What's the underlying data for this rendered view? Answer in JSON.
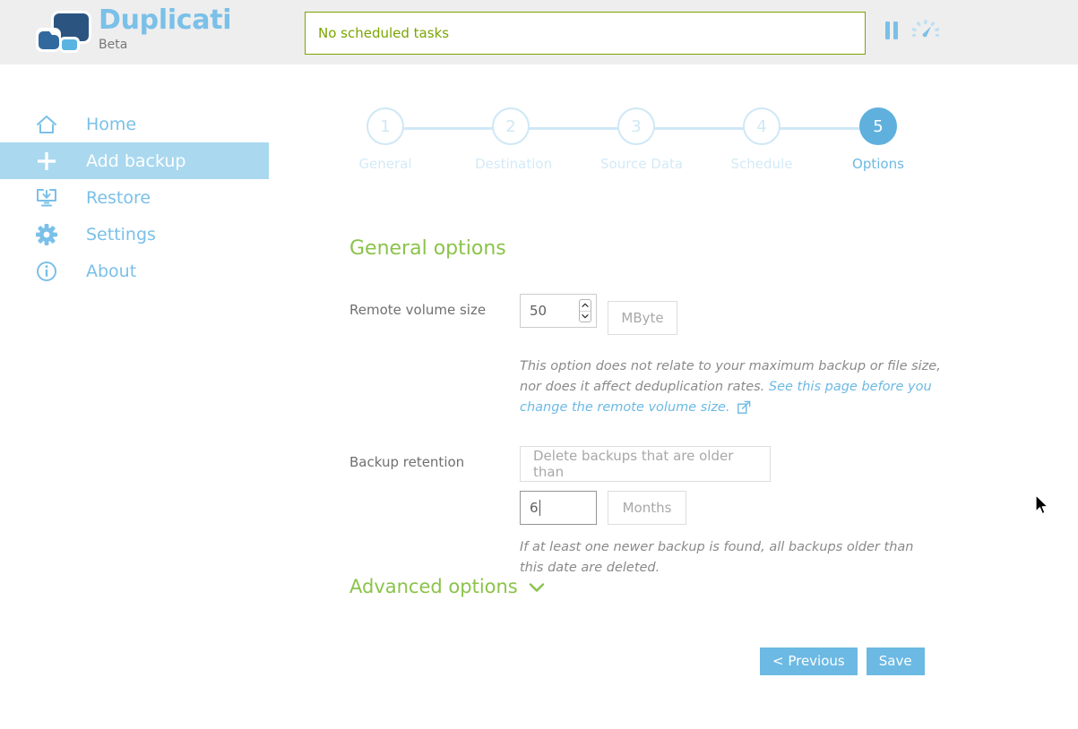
{
  "header": {
    "brand_title": "Duplicati",
    "brand_sub": "Beta",
    "logo_icon": "duplicati-logo-icon",
    "task_status": "No scheduled tasks",
    "pause_icon": "pause-icon",
    "throttle_icon": "speedometer-icon"
  },
  "sidebar": {
    "items": [
      {
        "label": "Home",
        "icon": "home-icon",
        "name": "home",
        "active": false
      },
      {
        "label": "Add backup",
        "icon": "plus-icon",
        "name": "add-backup",
        "active": true
      },
      {
        "label": "Restore",
        "icon": "restore-icon",
        "name": "restore",
        "active": false
      },
      {
        "label": "Settings",
        "icon": "gear-icon",
        "name": "settings",
        "active": false
      },
      {
        "label": "About",
        "icon": "info-circle-icon",
        "name": "about",
        "active": false
      }
    ]
  },
  "stepper": {
    "steps": [
      {
        "number": "1",
        "label": "General",
        "active": false
      },
      {
        "number": "2",
        "label": "Destination",
        "active": false
      },
      {
        "number": "3",
        "label": "Source Data",
        "active": false
      },
      {
        "number": "4",
        "label": "Schedule",
        "active": false
      },
      {
        "number": "5",
        "label": "Options",
        "active": true
      }
    ]
  },
  "main": {
    "section_title": "General options",
    "remote_volume": {
      "label": "Remote volume size",
      "value": "50",
      "unit": "MByte",
      "help_part1": "This option does not relate to your maximum backup or file size, nor does it affect deduplication rates. ",
      "help_link": "See this page before you change the remote volume size.",
      "help_link_icon": "external-link-icon"
    },
    "backup_retention": {
      "label": "Backup retention",
      "policy": "Delete backups that are older than",
      "value": "6",
      "unit": "Months",
      "help": "If at least one newer backup is found, all backups older than this date are deleted."
    },
    "advanced_options": {
      "label": "Advanced options",
      "chevron_icon": "chevron-down-icon"
    }
  },
  "actions": {
    "previous_label": "< Previous",
    "save_label": "Save"
  },
  "colors": {
    "brand_blue": "#7ac0e8",
    "accent_blue": "#6cb9e3",
    "active_nav": "#a9d8ef",
    "green": "#8bc34a",
    "status_green": "#7aa500",
    "header_bg": "#eeeeee"
  }
}
